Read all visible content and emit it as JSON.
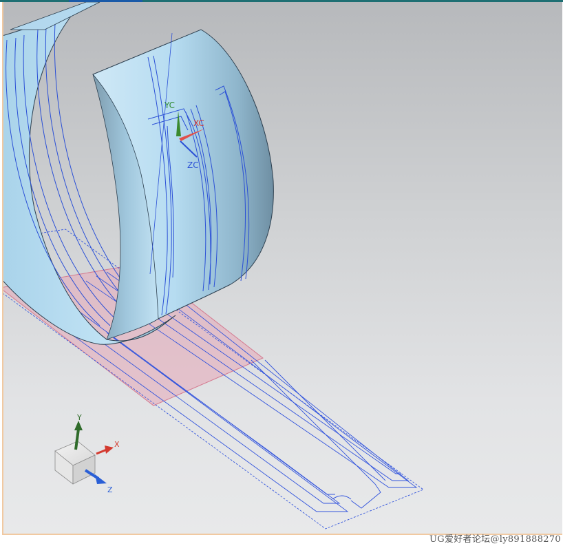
{
  "window": {
    "accent_color": "#1e6f73",
    "active_tab_color": "#1a5aa8"
  },
  "viewport": {
    "background_top": "#b7b9bc",
    "background_bottom": "#e8e9ea",
    "frame_color": "#f1c9a1"
  },
  "model": {
    "surface_color": "#a8d4ec",
    "curve_color": "#2a4fd6",
    "plane_color": "#e6a7b8"
  },
  "wcs_labels": {
    "yc": "YC",
    "xc": "XC",
    "zc": "ZC"
  },
  "triad": {
    "x_label": "X",
    "y_label": "Y",
    "z_label": "Z"
  },
  "watermark": {
    "text": "UG爱好者论坛@ly891888270"
  }
}
